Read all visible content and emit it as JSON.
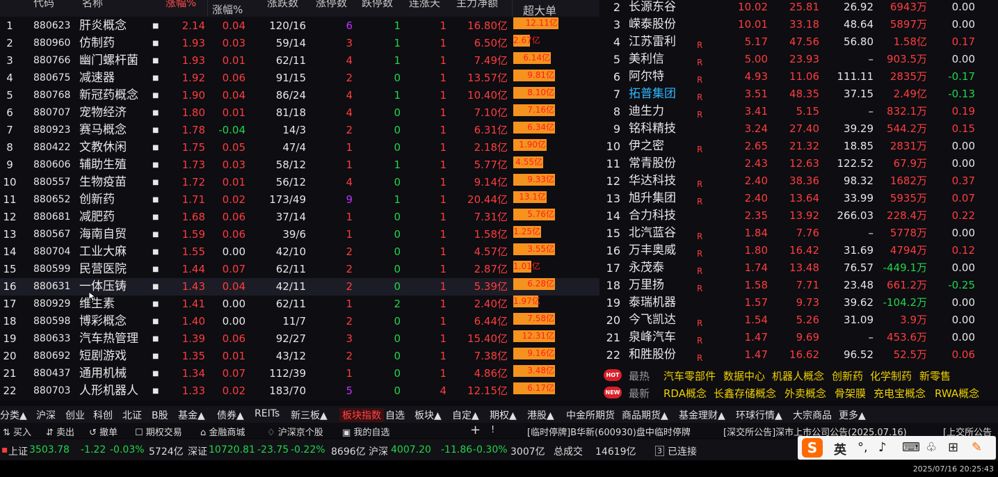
{
  "header": {
    "code": "代码",
    "name": "名称",
    "chg": "涨幅%",
    "speed": "涨幅%",
    "updown": "涨跌数",
    "lz": "涨停数",
    "dt": "跌停数",
    "lb": "连涨天",
    "amt": "主力净额",
    "big": "超大单"
  },
  "left_rows": [
    {
      "idx": "1",
      "code": "880623",
      "name": "肝炎概念",
      "chg": "2.14",
      "spd": "0.04",
      "ud": "120/16",
      "lz": "6",
      "lzc": "#c030ff",
      "dt": "1",
      "lb": "1",
      "amt": "16.80亿",
      "big": "12.11亿",
      "pct": 0.9
    },
    {
      "idx": "2",
      "code": "880960",
      "name": "仿制药",
      "chg": "1.93",
      "spd": "0.03",
      "ud": "59/14",
      "lz": "3",
      "lzc": "#ff3d3d",
      "dt": "1",
      "lb": "1",
      "amt": "6.50亿",
      "big": "2.67亿",
      "pct": 0.33
    },
    {
      "idx": "3",
      "code": "880766",
      "name": "幽门螺杆菌",
      "chg": "1.93",
      "spd": "0.01",
      "ud": "62/11",
      "lz": "4",
      "lzc": "#ff3d3d",
      "dt": "1",
      "lb": "1",
      "amt": "7.49亿",
      "big": "6.14亿",
      "pct": 0.75
    },
    {
      "idx": "4",
      "code": "880675",
      "name": "减速器",
      "chg": "1.92",
      "spd": "0.06",
      "ud": "91/15",
      "lz": "2",
      "lzc": "#ff3d3d",
      "dt": "0",
      "lb": "1",
      "amt": "13.57亿",
      "big": "9.81亿",
      "pct": 0.84
    },
    {
      "idx": "5",
      "code": "880768",
      "name": "新冠药概念",
      "chg": "1.90",
      "spd": "0.04",
      "ud": "86/24",
      "lz": "4",
      "lzc": "#ff3d3d",
      "dt": "1",
      "lb": "1",
      "amt": "10.40亿",
      "big": "8.10亿",
      "pct": 0.84
    },
    {
      "idx": "6",
      "code": "880707",
      "name": "宠物经济",
      "chg": "1.80",
      "spd": "0.01",
      "ud": "81/18",
      "lz": "4",
      "lzc": "#ff3d3d",
      "dt": "0",
      "lb": "1",
      "amt": "7.10亿",
      "big": "7.16亿",
      "pct": 0.84
    },
    {
      "idx": "7",
      "code": "880923",
      "name": "赛马概念",
      "chg": "1.78",
      "spd": "-0.04",
      "ud": "14/3",
      "lz": "2",
      "lzc": "#ff3d3d",
      "dt": "0",
      "lb": "1",
      "amt": "6.31亿",
      "big": "6.34亿",
      "pct": 0.84
    },
    {
      "idx": "8",
      "code": "880422",
      "name": "文教休闲",
      "chg": "1.75",
      "spd": "0.05",
      "ud": "47/4",
      "lz": "1",
      "lzc": "#ff3d3d",
      "dt": "0",
      "lb": "1",
      "amt": "2.18亿",
      "big": "1.90亿",
      "pct": 0.67
    },
    {
      "idx": "9",
      "code": "880606",
      "name": "辅助生殖",
      "chg": "1.73",
      "spd": "0.03",
      "ud": "58/12",
      "lz": "1",
      "lzc": "#ff3d3d",
      "dt": "1",
      "lb": "1",
      "amt": "5.77亿",
      "big": "4.55亿",
      "pct": 0.6
    },
    {
      "idx": "10",
      "code": "880557",
      "name": "生物疫苗",
      "chg": "1.72",
      "spd": "0.01",
      "ud": "56/12",
      "lz": "4",
      "lzc": "#ff3d3d",
      "dt": "0",
      "lb": "1",
      "amt": "9.14亿",
      "big": "9.33亿",
      "pct": 0.84
    },
    {
      "idx": "11",
      "code": "880652",
      "name": "创新药",
      "chg": "1.71",
      "spd": "0.02",
      "ud": "173/49",
      "lz": "9",
      "lzc": "#c030ff",
      "dt": "1",
      "lb": "1",
      "amt": "20.44亿",
      "big": "13.1亿",
      "pct": 0.66
    },
    {
      "idx": "12",
      "code": "880681",
      "name": "减肥药",
      "chg": "1.68",
      "spd": "0.06",
      "ud": "37/14",
      "lz": "1",
      "lzc": "#ff3d3d",
      "dt": "0",
      "lb": "1",
      "amt": "7.31亿",
      "big": "5.76亿",
      "pct": 0.84
    },
    {
      "idx": "13",
      "code": "880567",
      "name": "海南自贸",
      "chg": "1.59",
      "spd": "0.06",
      "ud": "39/6",
      "lz": "1",
      "lzc": "#ff3d3d",
      "dt": "0",
      "lb": "1",
      "amt": "1.58亿",
      "big": "1.25亿",
      "pct": 0.56
    },
    {
      "idx": "14",
      "code": "880704",
      "name": "工业大麻",
      "chg": "1.55",
      "spd": "0.00",
      "ud": "42/10",
      "lz": "2",
      "lzc": "#ff3d3d",
      "dt": "0",
      "lb": "1",
      "amt": "4.57亿",
      "big": "3.55亿",
      "pct": 0.84
    },
    {
      "idx": "15",
      "code": "880599",
      "name": "民营医院",
      "chg": "1.44",
      "spd": "0.07",
      "ud": "62/11",
      "lz": "2",
      "lzc": "#ff3d3d",
      "dt": "0",
      "lb": "1",
      "amt": "2.87亿",
      "big": "1.01亿",
      "pct": 0.36
    },
    {
      "idx": "16",
      "code": "880631",
      "name": "一体压铸",
      "chg": "1.43",
      "spd": "0.04",
      "ud": "42/11",
      "lz": "2",
      "lzc": "#ff3d3d",
      "dt": "0",
      "lb": "1",
      "amt": "5.39亿",
      "big": "6.28亿",
      "pct": 0.84
    },
    {
      "idx": "17",
      "code": "880929",
      "name": "维生素",
      "chg": "1.41",
      "spd": "0.00",
      "ud": "62/11",
      "lz": "1",
      "lzc": "#ff3d3d",
      "dt": "2",
      "lb": "1",
      "amt": "2.40亿",
      "big": "1.97亿",
      "pct": 0.5
    },
    {
      "idx": "18",
      "code": "880598",
      "name": "博彩概念",
      "chg": "1.40",
      "spd": "0.00",
      "ud": "11/7",
      "lz": "2",
      "lzc": "#ff3d3d",
      "dt": "0",
      "lb": "1",
      "amt": "6.44亿",
      "big": "7.58亿",
      "pct": 0.84
    },
    {
      "idx": "19",
      "code": "880633",
      "name": "汽车热管理",
      "chg": "1.39",
      "spd": "0.06",
      "ud": "92/27",
      "lz": "3",
      "lzc": "#ff3d3d",
      "dt": "0",
      "lb": "1",
      "amt": "15.40亿",
      "big": "12.31亿",
      "pct": 0.84
    },
    {
      "idx": "20",
      "code": "880692",
      "name": "短剧游戏",
      "chg": "1.35",
      "spd": "0.01",
      "ud": "43/12",
      "lz": "2",
      "lzc": "#ff3d3d",
      "dt": "0",
      "lb": "1",
      "amt": "7.38亿",
      "big": "9.16亿",
      "pct": 0.84
    },
    {
      "idx": "21",
      "code": "880437",
      "name": "通用机械",
      "chg": "1.34",
      "spd": "0.07",
      "ud": "112/39",
      "lz": "1",
      "lzc": "#ff3d3d",
      "dt": "0",
      "lb": "1",
      "amt": "4.86亿",
      "big": "3.48亿",
      "pct": 0.84
    },
    {
      "idx": "22",
      "code": "880703",
      "name": "人形机器人",
      "chg": "1.33",
      "spd": "0.02",
      "ud": "183/70",
      "lz": "5",
      "lzc": "#c030ff",
      "dt": "0",
      "lb": "4",
      "amt": "12.15亿",
      "big": "6.17亿",
      "pct": 0.84
    }
  ],
  "right_rows": [
    {
      "idx": "2",
      "name": "长源东谷",
      "flag": "",
      "chg": "10.02",
      "amp": "25.81",
      "pe": "26.92",
      "amt": "6943万",
      "spd": "0.00",
      "namec": "#e8e8e8"
    },
    {
      "idx": "3",
      "name": "嵘泰股份",
      "flag": "",
      "chg": "10.01",
      "amp": "33.18",
      "pe": "48.64",
      "amt": "5897万",
      "spd": "0.00",
      "namec": "#e8e8e8"
    },
    {
      "idx": "4",
      "name": "江苏雷利",
      "flag": "R",
      "chg": "5.17",
      "amp": "47.56",
      "pe": "56.80",
      "amt": "1.58亿",
      "spd": "0.17",
      "namec": "#e8e8e8"
    },
    {
      "idx": "5",
      "name": "美利信",
      "flag": "R",
      "chg": "5.00",
      "amp": "23.93",
      "pe": "–",
      "amt": "903.5万",
      "spd": "0.00",
      "namec": "#e8e8e8"
    },
    {
      "idx": "6",
      "name": "阿尔特",
      "flag": "R",
      "chg": "4.93",
      "amp": "11.06",
      "pe": "111.11",
      "amt": "2835万",
      "spd": "-0.17",
      "namec": "#e8e8e8"
    },
    {
      "idx": "7",
      "name": "拓普集团",
      "flag": "R",
      "chg": "3.51",
      "amp": "48.35",
      "pe": "37.15",
      "amt": "2.49亿",
      "spd": "-0.13",
      "namec": "#30b8ff"
    },
    {
      "idx": "8",
      "name": "迪生力",
      "flag": "R",
      "chg": "3.41",
      "amp": "5.15",
      "pe": "–",
      "amt": "832.1万",
      "spd": "0.19",
      "namec": "#e8e8e8"
    },
    {
      "idx": "9",
      "name": "铭科精技",
      "flag": "",
      "chg": "3.24",
      "amp": "27.40",
      "pe": "39.29",
      "amt": "544.2万",
      "spd": "0.15",
      "namec": "#e8e8e8"
    },
    {
      "idx": "10",
      "name": "伊之密",
      "flag": "R",
      "chg": "2.65",
      "amp": "21.32",
      "pe": "18.85",
      "amt": "2831万",
      "spd": "0.00",
      "namec": "#e8e8e8"
    },
    {
      "idx": "11",
      "name": "常青股份",
      "flag": "",
      "chg": "2.43",
      "amp": "12.63",
      "pe": "122.52",
      "amt": "67.9万",
      "spd": "0.00",
      "namec": "#e8e8e8"
    },
    {
      "idx": "12",
      "name": "华达科技",
      "flag": "R",
      "chg": "2.40",
      "amp": "38.36",
      "pe": "98.32",
      "amt": "1682万",
      "spd": "0.37",
      "namec": "#e8e8e8"
    },
    {
      "idx": "13",
      "name": "旭升集团",
      "flag": "R",
      "chg": "2.40",
      "amp": "13.64",
      "pe": "33.99",
      "amt": "5935万",
      "spd": "0.07",
      "namec": "#e8e8e8"
    },
    {
      "idx": "14",
      "name": "合力科技",
      "flag": "",
      "chg": "2.35",
      "amp": "13.92",
      "pe": "266.03",
      "amt": "228.4万",
      "spd": "0.22",
      "namec": "#e8e8e8"
    },
    {
      "idx": "15",
      "name": "北汽蓝谷",
      "flag": "R",
      "chg": "1.84",
      "amp": "7.76",
      "pe": "–",
      "amt": "5778万",
      "spd": "0.00",
      "namec": "#e8e8e8"
    },
    {
      "idx": "16",
      "name": "万丰奥威",
      "flag": "R",
      "chg": "1.80",
      "amp": "16.42",
      "pe": "31.69",
      "amt": "4794万",
      "spd": "0.12",
      "namec": "#e8e8e8"
    },
    {
      "idx": "17",
      "name": "永茂泰",
      "flag": "R",
      "chg": "1.74",
      "amp": "13.48",
      "pe": "76.57",
      "amt": "-449.1万",
      "spd": "0.00",
      "namec": "#e8e8e8"
    },
    {
      "idx": "18",
      "name": "万里扬",
      "flag": "R",
      "chg": "1.58",
      "amp": "7.71",
      "pe": "23.48",
      "amt": "661.2万",
      "spd": "-0.25",
      "namec": "#e8e8e8"
    },
    {
      "idx": "19",
      "name": "泰瑞机器",
      "flag": "",
      "chg": "1.57",
      "amp": "9.73",
      "pe": "39.62",
      "amt": "-104.2万",
      "spd": "0.00",
      "namec": "#e8e8e8"
    },
    {
      "idx": "20",
      "name": "今飞凯达",
      "flag": "R",
      "chg": "1.54",
      "amp": "5.26",
      "pe": "31.09",
      "amt": "3.9万",
      "spd": "0.00",
      "namec": "#e8e8e8"
    },
    {
      "idx": "21",
      "name": "泉峰汽车",
      "flag": "R",
      "chg": "1.47",
      "amp": "9.69",
      "pe": "–",
      "amt": "453.6万",
      "spd": "0.00",
      "namec": "#e8e8e8"
    },
    {
      "idx": "22",
      "name": "和胜股份",
      "flag": "R",
      "chg": "1.47",
      "amp": "16.62",
      "pe": "96.52",
      "amt": "52.5万",
      "spd": "0.06",
      "namec": "#e8e8e8"
    }
  ],
  "hot": {
    "badge": "HOT",
    "label": "最热",
    "tags": [
      "汽车零部件",
      "数据中心",
      "机器人概念",
      "创新药",
      "化学制药",
      "新零售"
    ]
  },
  "new": {
    "badge": "NEW",
    "label": "最新",
    "tags": [
      "RDA概念",
      "长鑫存储概念",
      "外卖概念",
      "骨架膜",
      "充电宝概念",
      "RWA概念"
    ]
  },
  "tabs": [
    "分类▲",
    "沪深",
    "创业",
    "科创",
    "北证",
    "B股",
    "基金▲",
    "债券▲",
    "REITs",
    "新三板▲",
    "板块指数",
    "自选",
    "板块▲",
    "自定▲",
    "期权▲",
    "港股▲",
    "中金所期货",
    "商品期货▲",
    "基金理财▲",
    "环球行情▲",
    "大宗商品",
    "更多▲"
  ],
  "toolbar": {
    "buy": "买入",
    "sell": "卖出",
    "cancel": "撤单",
    "option": "期权交易",
    "mall": "金融商城",
    "hk": "沪深京个股",
    "fav": "我的自选",
    "plus": "+",
    "excl": "!",
    "notice1": "[临时停牌]B华新(600930)盘中临时停牌",
    "notice2": "[深交所公告]深市上市公司公告(2025.07.16)",
    "notice3": "[上交所公告"
  },
  "status": {
    "sh_label": "上证",
    "sh_val": "3503.78",
    "sh_chg": "-1.22",
    "sh_pct": "-0.03%",
    "sh_amt": "5724亿",
    "sz_label": "深证",
    "sz_val": "10720.81",
    "sz_chg": "-23.75",
    "sz_pct": "-0.22%",
    "sz_amt": "8696亿",
    "hs_label": "沪深",
    "hs_val": "4007.20",
    "hs_chg": "-11.86",
    "hs_pct": "-0.30%",
    "hs_amt": "3007亿",
    "total_label": "总成交",
    "total_amt": "14619亿",
    "conn": "已连接"
  },
  "ime": {
    "lang": "英"
  },
  "clock": "2025/07/16 20:25:43"
}
